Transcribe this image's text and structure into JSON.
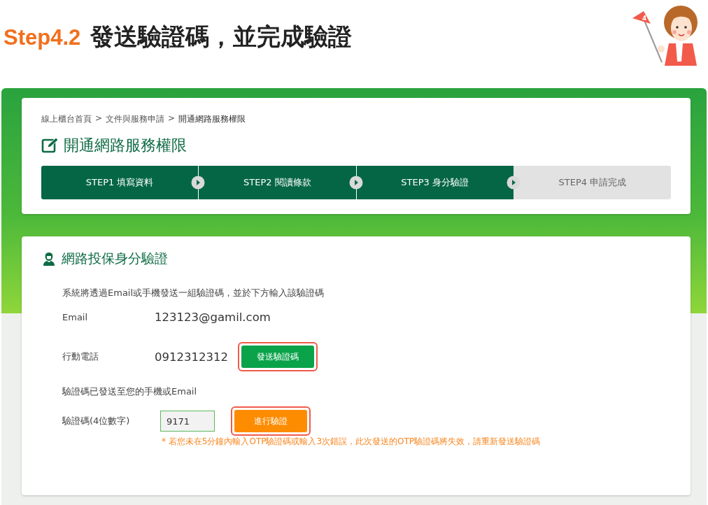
{
  "heading": {
    "step": "Step4.2",
    "title": "發送驗證碼，並完成驗證"
  },
  "mascot": {
    "flag_label": "4"
  },
  "breadcrumb": [
    {
      "label": "線上櫃台首頁"
    },
    {
      "label": "文件與服務申請"
    },
    {
      "label": "開通網路服務權限"
    }
  ],
  "breadcrumb_separator": ">",
  "page_title": "開通網路服務權限",
  "steps": [
    {
      "label": "STEP1 填寫資料",
      "done": true
    },
    {
      "label": "STEP2 閱讀條款",
      "done": true
    },
    {
      "label": "STEP3 身分驗證",
      "done": true
    },
    {
      "label": "STEP4 申請完成",
      "done": false
    }
  ],
  "section": {
    "title": "網路投保身分驗證",
    "intro": "系統將透過Email或手機發送一組驗證碼，並於下方輸入該驗證碼",
    "email_label": "Email",
    "email_value": "123123@gamil.com",
    "phone_label": "行動電話",
    "phone_value": "0912312312",
    "send_button": {
      "label": "發送驗證碼",
      "highlighted": true
    },
    "sent_notice": "驗證碼已發送至您的手機或Email",
    "code_label": "驗證碼(4位數字)",
    "code_value": "9171",
    "verify_button": {
      "label": "進行驗證",
      "highlighted": true
    },
    "warning": "* 若您未在5分鐘內輸入OTP驗證碼或輸入3次錯誤，此次發送的OTP驗證碼將失效，請重新發送驗證碼"
  }
}
